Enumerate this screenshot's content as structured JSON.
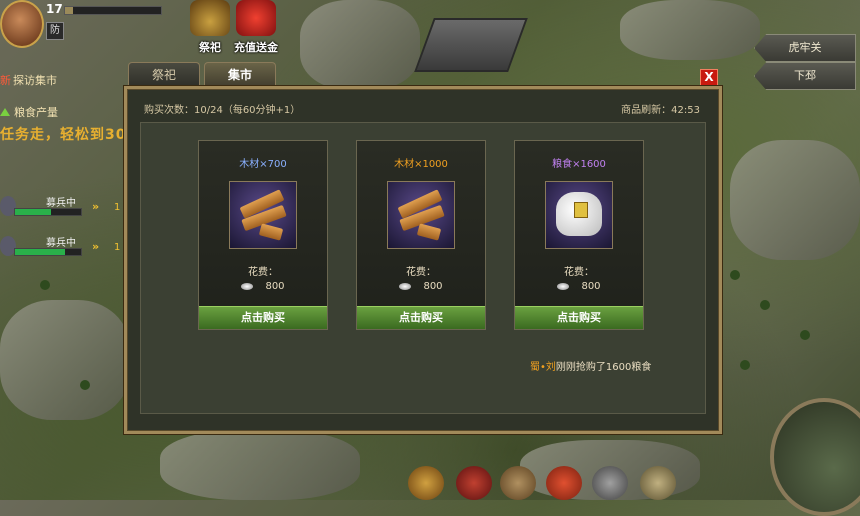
{
  "player": {
    "level": "17",
    "defense_tag": "防",
    "exp_fraction": 0.08
  },
  "quest": {
    "title_prefix": "新",
    "title": "探访集市",
    "grain_label": "粮食产量",
    "text": "任务走，轻松到30"
  },
  "recruits": [
    {
      "label": "募兵中",
      "progress": 0.55,
      "chevrons": "»",
      "count": "1"
    },
    {
      "label": "募兵中",
      "progress": 0.75,
      "chevrons": "»",
      "count": "1"
    }
  ],
  "top_icons": {
    "sacrifice_label": "祭祀",
    "recharge_label": "充值送金"
  },
  "locations": [
    "虎牢关",
    "下邳"
  ],
  "dialog": {
    "tabs": [
      "祭祀",
      "集市"
    ],
    "active_tab": 1,
    "close_label": "X",
    "purchase_count": "购买次数：10/24（每60分钟+1）",
    "refresh": "商品刷新：42:53",
    "cost_label": "花费：",
    "items": [
      {
        "name": "木材×700",
        "name_color": "#8ab0ff",
        "price": "800",
        "button": "点击购买",
        "icon": "wood-icon"
      },
      {
        "name": "木材×1000",
        "name_color": "#f0a020",
        "price": "800",
        "button": "点击购买",
        "icon": "wood-icon"
      },
      {
        "name": "粮食×1600",
        "name_color": "#c080f0",
        "price": "800",
        "button": "点击购买",
        "icon": "grain-sack-icon"
      }
    ],
    "news": {
      "who": "蜀•刘",
      "text": "刚刚抢购了1600粮食"
    }
  },
  "colors": {
    "frame": "#a28a5a",
    "buy_button": "#4a8a30",
    "close_button": "#c81a10"
  }
}
